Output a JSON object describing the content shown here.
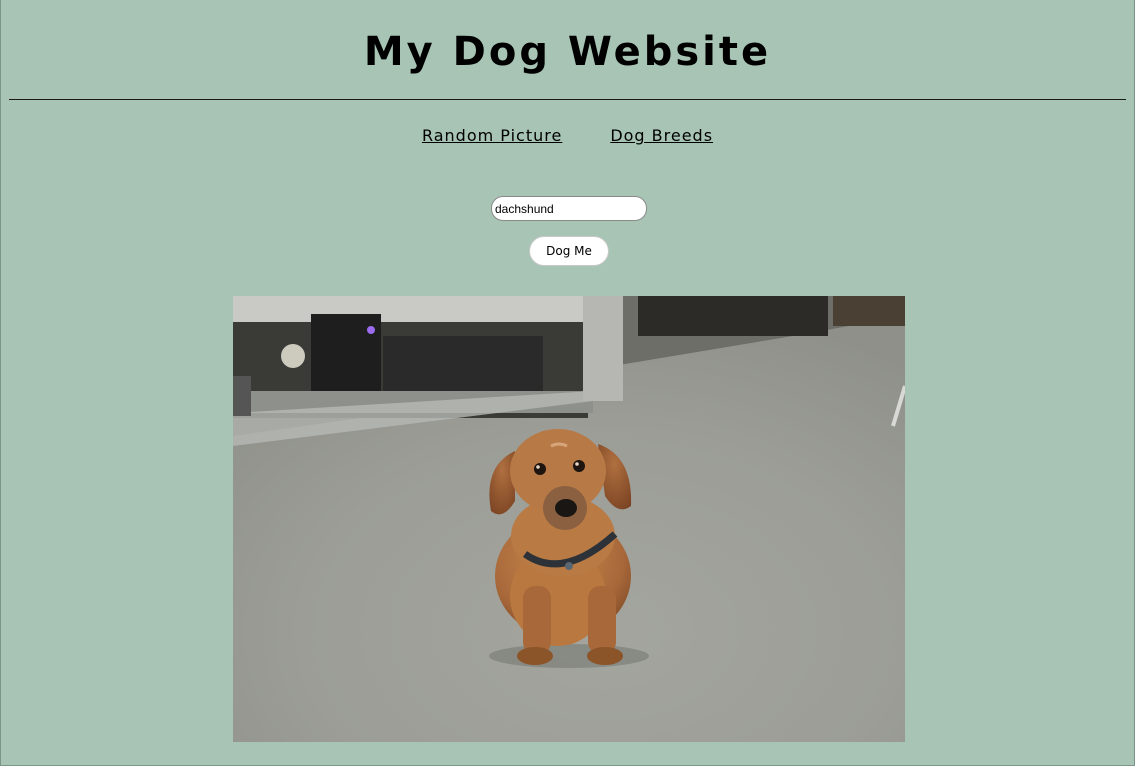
{
  "header": {
    "title": "My Dog Website"
  },
  "nav": {
    "items": [
      {
        "label": "Random Picture"
      },
      {
        "label": "Dog Breeds"
      }
    ]
  },
  "search": {
    "value": "dachshund"
  },
  "action": {
    "button_label": "Dog Me"
  },
  "image": {
    "subject": "dachshund sitting on carpet"
  },
  "colors": {
    "page_background": "#a7c4b4",
    "text": "#000000"
  }
}
